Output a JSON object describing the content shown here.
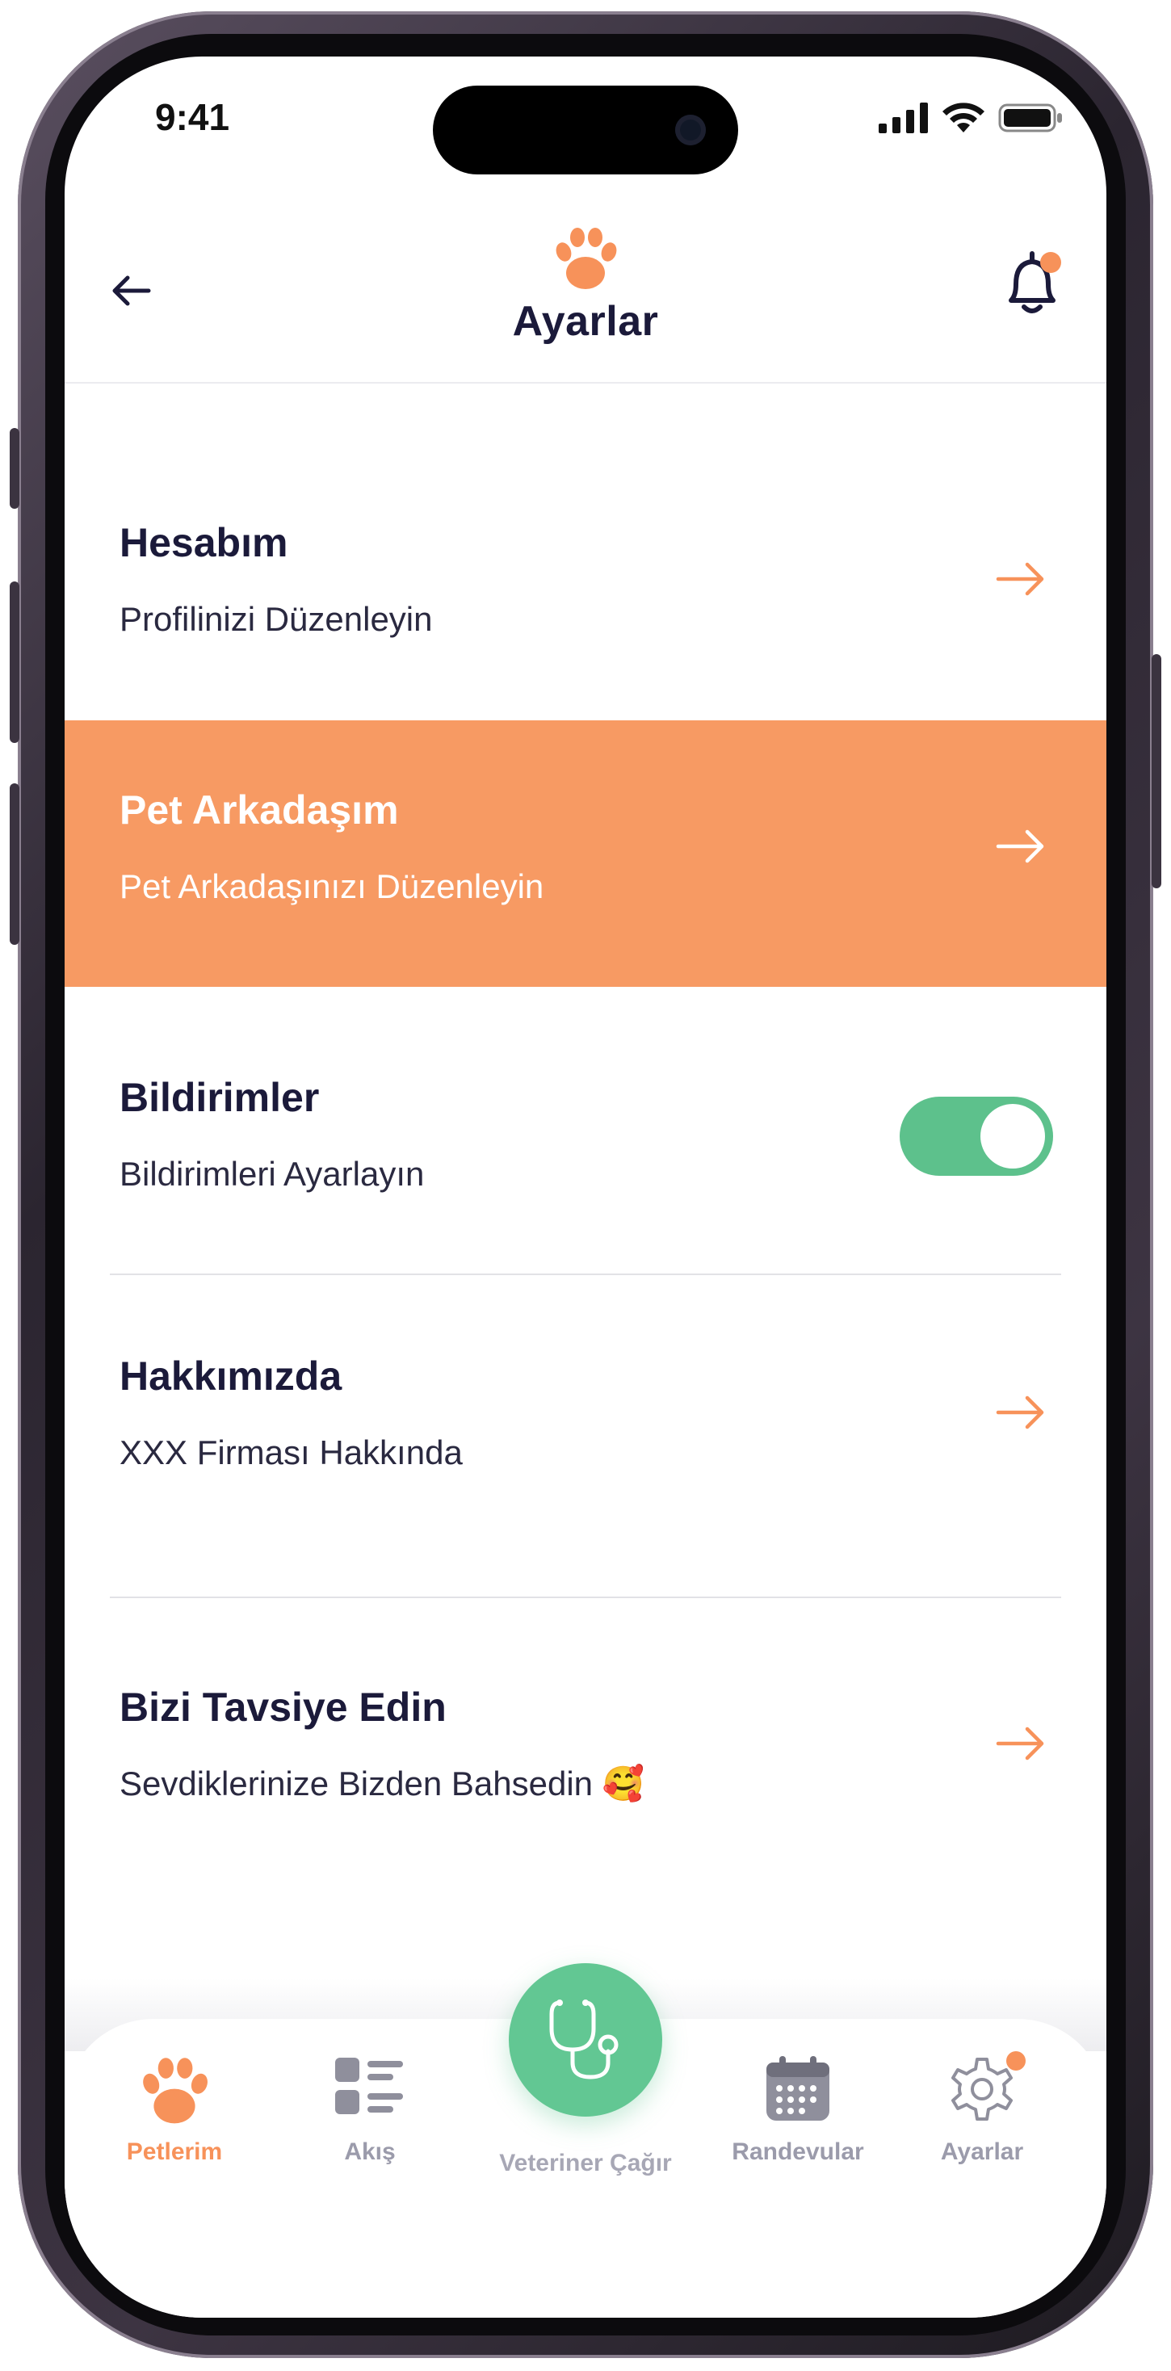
{
  "status_bar": {
    "time": "9:41"
  },
  "header": {
    "title": "Ayarlar"
  },
  "settings": [
    {
      "title": "Hesabım",
      "subtitle": "Profilinizi Düzenleyin"
    },
    {
      "title": "Pet Arkadaşım",
      "subtitle": "Pet Arkadaşınızı Düzenleyin"
    },
    {
      "title": "Bildirimler",
      "subtitle": "Bildirimleri Ayarlayın",
      "toggle_on": true
    },
    {
      "title": "Hakkımızda",
      "subtitle": "XXX Firması Hakkında"
    },
    {
      "title": "Bizi Tavsiye Edin",
      "subtitle": "Sevdiklerinize Bizden Bahsedin 🥰"
    }
  ],
  "tabbar": {
    "tabs": [
      {
        "label": "Petlerim",
        "icon": "paw-icon",
        "active": true
      },
      {
        "label": "Akış",
        "icon": "feed-list-icon"
      },
      {
        "label": "Veteriner Çağır",
        "icon": "stethoscope-icon"
      },
      {
        "label": "Randevular",
        "icon": "calendar-icon"
      },
      {
        "label": "Ayarlar",
        "icon": "gear-icon"
      }
    ]
  },
  "colors": {
    "accent_orange": "#f79a63",
    "toggle_green": "#5dc18c",
    "fab_green": "#62c793",
    "text_dark": "#1b1a3a",
    "tab_inactive": "#9b9bab"
  }
}
